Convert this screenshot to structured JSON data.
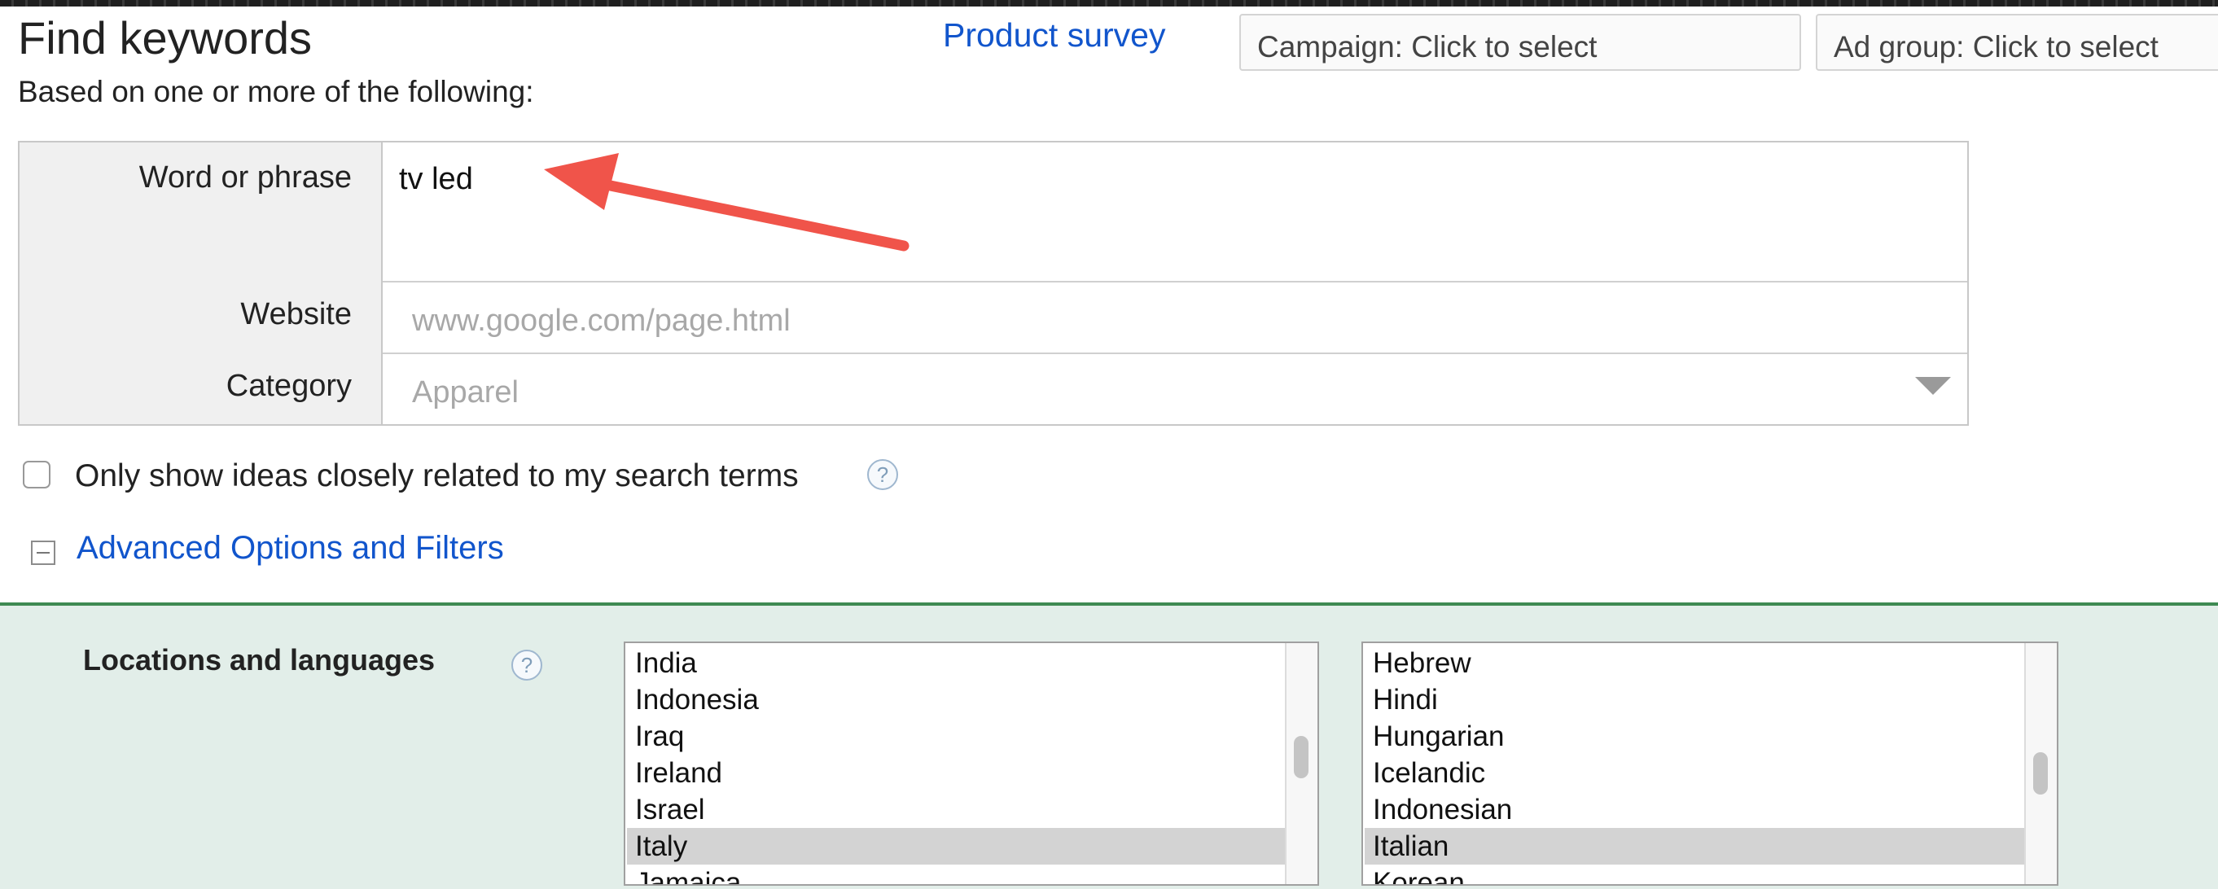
{
  "header": {
    "title": "Find keywords",
    "subtitle": "Based on one or more of the following:",
    "survey_link": "Product survey",
    "campaign_picker": "Campaign: Click to select",
    "adgroup_picker": "Ad group: Click to select"
  },
  "form": {
    "word_label": "Word or phrase",
    "word_value": "tv led",
    "website_label": "Website",
    "website_placeholder": "www.google.com/page.html",
    "category_label": "Category",
    "category_placeholder": "Apparel"
  },
  "options": {
    "closely_related_label": "Only show ideas closely related to my search terms",
    "closely_related_checked": false,
    "help_icon": "?",
    "advanced_link": "Advanced Options and Filters"
  },
  "filters": {
    "locations_label": "Locations and languages",
    "locations": [
      {
        "label": "India",
        "selected": false
      },
      {
        "label": "Indonesia",
        "selected": false
      },
      {
        "label": "Iraq",
        "selected": false
      },
      {
        "label": "Ireland",
        "selected": false
      },
      {
        "label": "Israel",
        "selected": false
      },
      {
        "label": "Italy",
        "selected": true
      },
      {
        "label": "Jamaica",
        "selected": false
      }
    ],
    "languages": [
      {
        "label": "Hebrew",
        "selected": false
      },
      {
        "label": "Hindi",
        "selected": false
      },
      {
        "label": "Hungarian",
        "selected": false
      },
      {
        "label": "Icelandic",
        "selected": false
      },
      {
        "label": "Indonesian",
        "selected": false
      },
      {
        "label": "Italian",
        "selected": true
      },
      {
        "label": "Korean",
        "selected": false
      }
    ]
  },
  "annotation": {
    "arrow_color": "#f0544a"
  },
  "colors": {
    "link": "#1155cc",
    "panel_bg": "#e2eee9",
    "panel_border": "#3e8a52",
    "selected_row": "#d3d3d3"
  }
}
